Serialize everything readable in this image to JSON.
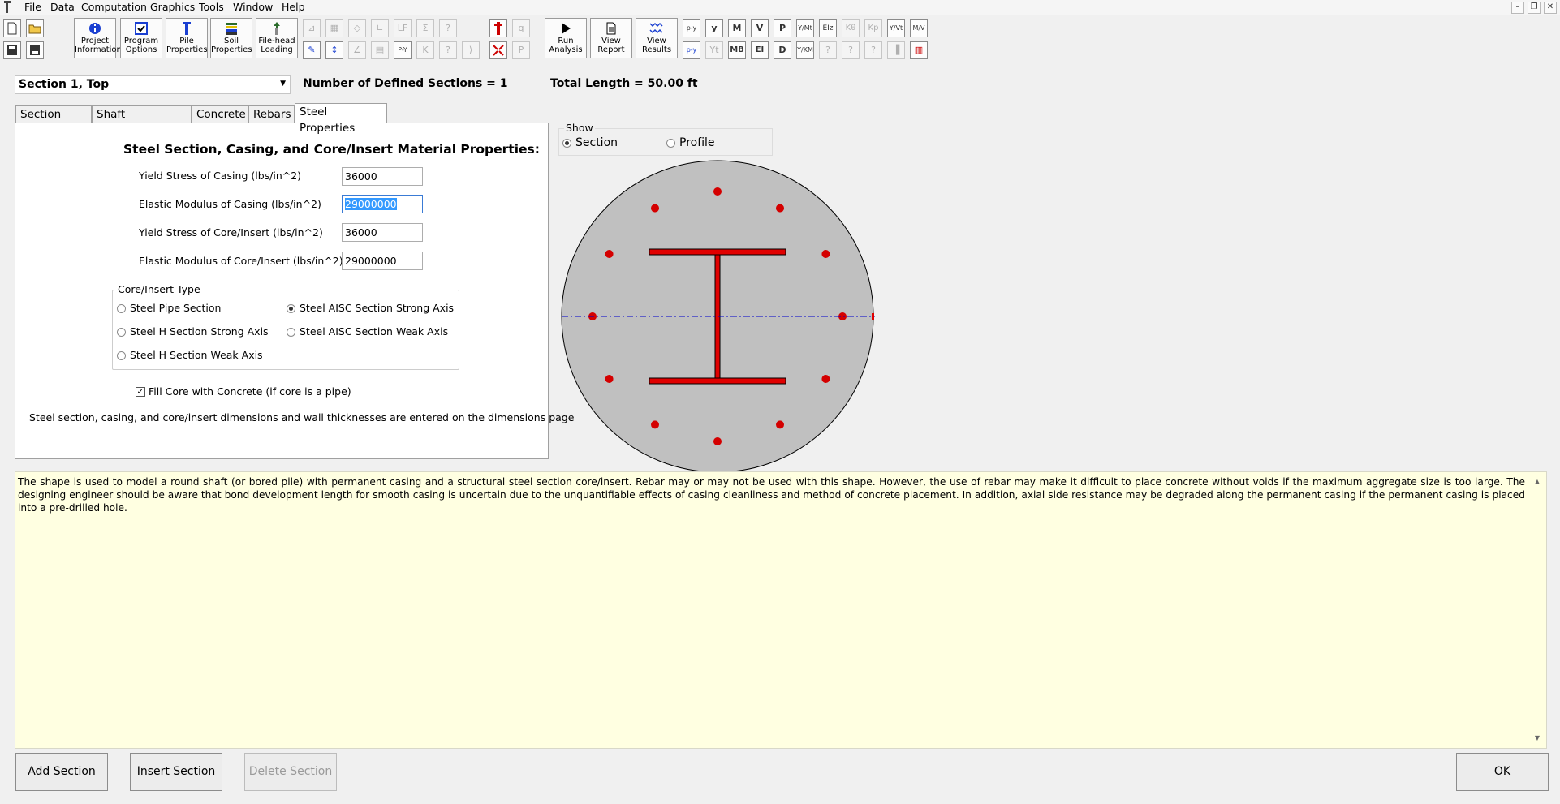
{
  "menu": {
    "items": [
      "File",
      "Data",
      "Computation",
      "Graphics",
      "Tools",
      "Window",
      "Help"
    ],
    "window_buttons": [
      "–",
      "❐",
      "✕"
    ]
  },
  "toolbar": {
    "big_buttons": [
      {
        "name": "project-information",
        "line1": "Project",
        "line2": "Information",
        "icon": "info-icon"
      },
      {
        "name": "program-options",
        "line1": "Program",
        "line2": "Options",
        "icon": "checkbox-icon"
      },
      {
        "name": "pile-properties",
        "line1": "Pile",
        "line2": "Properties",
        "icon": "pile-icon"
      },
      {
        "name": "soil-properties",
        "line1": "Soil",
        "line2": "Properties",
        "icon": "soil-layers-icon"
      },
      {
        "name": "file-head-loading",
        "line1": "File-head",
        "line2": "Loading",
        "icon": "loading-icon"
      },
      {
        "name": "run-analysis",
        "line1": "Run",
        "line2": "Analysis",
        "icon": "play-icon"
      },
      {
        "name": "view-report",
        "line1": "View",
        "line2": "Report",
        "icon": "report-icon"
      },
      {
        "name": "view-results",
        "line1": "View",
        "line2": "Results",
        "icon": "results-icon"
      }
    ],
    "graph_row1": [
      "p-y",
      "y",
      "M",
      "V",
      "P",
      "Y/Mt",
      "EIz",
      "Kθ",
      "Kp",
      "Y/Vt",
      "M/V"
    ],
    "graph_row2": [
      "p-y",
      "Yt",
      "MB",
      "EI",
      "D",
      "Y/KM",
      "?",
      "?",
      "?",
      "▐",
      "▥"
    ],
    "mid_row1": [
      "⊿",
      "▦",
      "◇",
      "∟",
      "LF",
      "Σ",
      "?"
    ],
    "mid_row2": [
      "✎",
      "↕",
      "∠",
      "▤",
      "P-Y",
      "K",
      "?",
      "⟩"
    ]
  },
  "section": {
    "selected": "Section 1, Top",
    "count_text": "Number of Defined Sections = 1",
    "length_text": "Total Length = 50.00 ft"
  },
  "tabs": [
    {
      "label": "Section Type",
      "active": false
    },
    {
      "label": "Shaft Dimensions",
      "active": false
    },
    {
      "label": "Concrete",
      "active": false
    },
    {
      "label": "Rebars",
      "active": false
    },
    {
      "label": "Steel Properties",
      "active": true
    }
  ],
  "panel": {
    "heading": "Steel Section, Casing, and Core/Insert Material Properties:",
    "fields": [
      {
        "label": "Yield Stress of Casing (lbs/in^2)",
        "value": "36000"
      },
      {
        "label": "Elastic Modulus of Casing (lbs/in^2)",
        "value": "29000000"
      },
      {
        "label": "Yield Stress of Core/Insert (lbs/in^2)",
        "value": "36000"
      },
      {
        "label": "Elastic Modulus of Core/Insert (lbs/in^2)",
        "value": "29000000"
      }
    ],
    "core_type": {
      "legend": "Core/Insert Type",
      "options": [
        {
          "label": "Steel Pipe Section",
          "checked": false
        },
        {
          "label": "Steel AISC Section Strong Axis",
          "checked": true
        },
        {
          "label": "Steel H Section Strong Axis",
          "checked": false
        },
        {
          "label": "Steel AISC Section Weak Axis",
          "checked": false
        },
        {
          "label": "Steel H Section Weak Axis",
          "checked": false
        }
      ]
    },
    "fill_core": {
      "label": "Fill Core with Concrete (if core is a pipe)",
      "checked": true
    },
    "note": "Steel section, casing, and core/insert dimensions and wall thicknesses are entered on the dimensions page"
  },
  "show": {
    "legend": "Show",
    "options": [
      {
        "label": "Section",
        "checked": true
      },
      {
        "label": "Profile",
        "checked": false
      }
    ]
  },
  "section_drawing": {
    "fill_color": "#c0c0c0",
    "steel_color": "#e00000",
    "rebar_color": "#d40000",
    "axis_color": "#0000cc",
    "rebar_count": 12
  },
  "description": "The shape is used to model a round shaft (or bored pile) with permanent casing and a structural steel section core/insert. Rebar may or may not be used with this shape. However, the use of rebar may make it difficult to place concrete without voids if the maximum aggregate size is too large. The designing engineer should be aware that bond development length for smooth casing is uncertain due to the unquantifiable effects of casing cleanliness and method of concrete placement. In addition, axial side resistance may be degraded along the permanent casing if the permanent casing is placed into a pre-drilled hole.",
  "buttons": {
    "add": "Add Section",
    "insert": "Insert Section",
    "delete": "Delete Section",
    "ok": "OK"
  }
}
